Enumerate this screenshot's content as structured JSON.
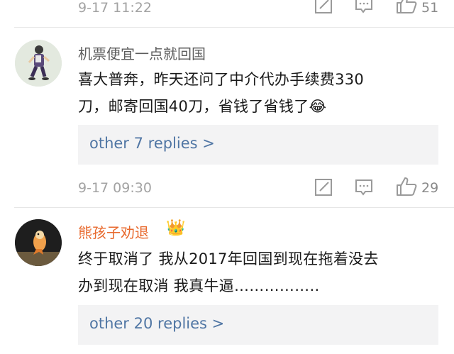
{
  "comments": [
    {
      "time": "9-17 11:22",
      "likes": "51"
    },
    {
      "username": "机票便宜一点就回国",
      "text_lines": [
        "喜大普奔，昨天还问了中介代办手续费330",
        "刀，邮寄回国40刀，省钱了省钱了😂"
      ],
      "replies": "other 7 replies >",
      "time": "9-17 09:30",
      "likes": "29"
    },
    {
      "username": "熊孩子劝退",
      "username_emoji": "👑",
      "text_lines": [
        "终于取消了 我从2017年回国到现在拖着没去",
        "办到现在取消 我真牛逼…………….."
      ],
      "replies": "other 20 replies >"
    }
  ],
  "colors": {
    "username_1": "#5c5c5c",
    "username_2": "#e8692d",
    "link": "#5076a4",
    "meta": "#a3a3a3"
  },
  "icons": [
    "edit-icon",
    "comment-icon",
    "thumbs-up-icon"
  ]
}
